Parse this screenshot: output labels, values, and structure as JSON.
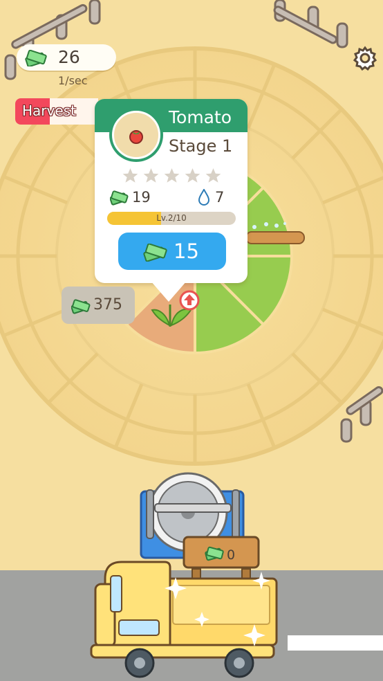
{
  "hud": {
    "money": "26",
    "money_rate": "1/sec",
    "harvest_label": "Harvest",
    "harvest_progress": 0.42
  },
  "crop_popup": {
    "name": "Tomato",
    "stage": "Stage 1",
    "stars_filled": 0,
    "stars_total": 5,
    "income_value": "19",
    "water_value": "7",
    "level_label": "Lv.2/10",
    "level_progress": 0.42,
    "upgrade_price": "15"
  },
  "plot": {
    "price": "375"
  },
  "truck": {
    "crate_value": "0"
  },
  "colors": {
    "ground": "#f6dfa0",
    "popup_header": "#2f9e6e",
    "upgrade_button": "#34a9ef",
    "harvest_red": "#f3485c",
    "level_yellow": "#f5c435",
    "grass": "#97cc4f"
  },
  "icons": {
    "money": "cash-stack-icon",
    "water": "water-drop-icon",
    "settings": "gear-icon",
    "upgrade": "up-arrow-icon",
    "star": "star-icon",
    "crop": "tomato-icon"
  }
}
